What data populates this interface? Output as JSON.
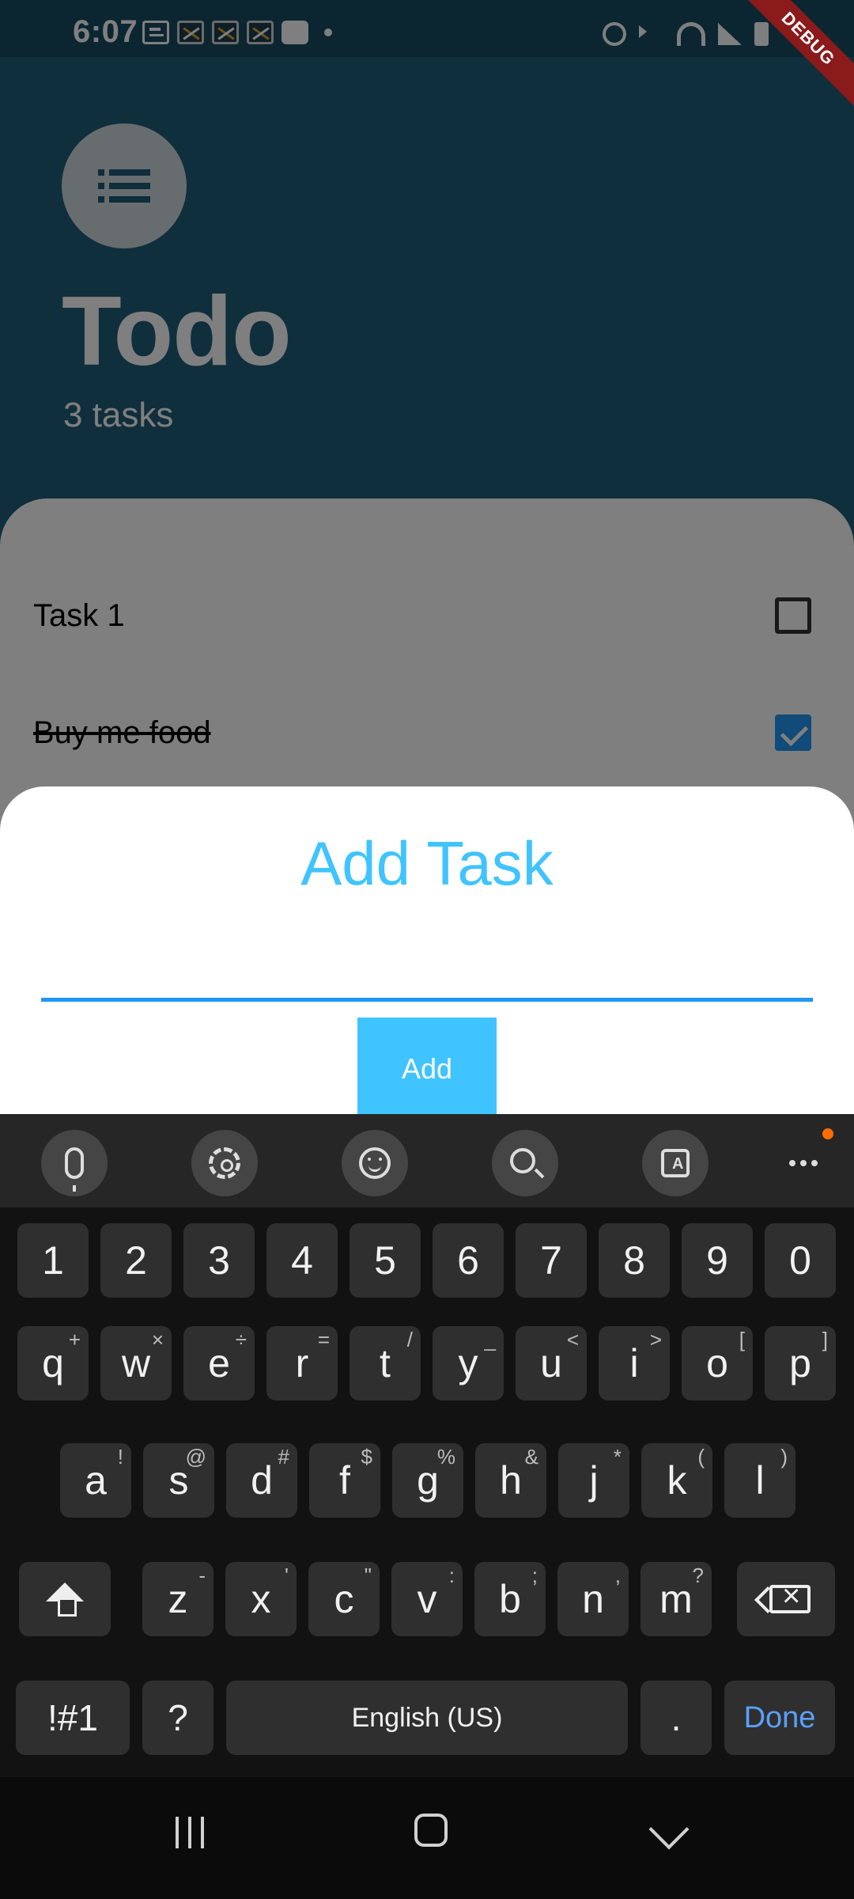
{
  "status_bar": {
    "time": "6:07",
    "debug_banner": "DEBUG"
  },
  "app": {
    "title": "Todo",
    "subtitle": "3 tasks"
  },
  "tasks": [
    {
      "label": "Task 1",
      "done": false
    },
    {
      "label": "Buy me food",
      "done": true
    }
  ],
  "dialog": {
    "title": "Add Task",
    "input_value": "",
    "add_label": "Add"
  },
  "keyboard": {
    "toolbar": [
      "mic-icon",
      "gear-icon",
      "emoji-icon",
      "search-icon",
      "translate-icon",
      "more-icon"
    ],
    "numbers": [
      "1",
      "2",
      "3",
      "4",
      "5",
      "6",
      "7",
      "8",
      "9",
      "0"
    ],
    "row1": [
      {
        "key": "q",
        "sup": "+"
      },
      {
        "key": "w",
        "sup": "×"
      },
      {
        "key": "e",
        "sup": "÷"
      },
      {
        "key": "r",
        "sup": "="
      },
      {
        "key": "t",
        "sup": "/"
      },
      {
        "key": "y",
        "sup": "_"
      },
      {
        "key": "u",
        "sup": "<"
      },
      {
        "key": "i",
        "sup": ">"
      },
      {
        "key": "o",
        "sup": "["
      },
      {
        "key": "p",
        "sup": "]"
      }
    ],
    "row2": [
      {
        "key": "a",
        "sup": "!"
      },
      {
        "key": "s",
        "sup": "@"
      },
      {
        "key": "d",
        "sup": "#"
      },
      {
        "key": "f",
        "sup": "$"
      },
      {
        "key": "g",
        "sup": "%"
      },
      {
        "key": "h",
        "sup": "&"
      },
      {
        "key": "j",
        "sup": "*"
      },
      {
        "key": "k",
        "sup": "("
      },
      {
        "key": "l",
        "sup": ")"
      }
    ],
    "row3": [
      {
        "key": "z",
        "sup": "-"
      },
      {
        "key": "x",
        "sup": "'"
      },
      {
        "key": "c",
        "sup": "\""
      },
      {
        "key": "v",
        "sup": ":"
      },
      {
        "key": "b",
        "sup": ";"
      },
      {
        "key": "n",
        "sup": ","
      },
      {
        "key": "m",
        "sup": "?"
      }
    ],
    "symbols_label": "!#1",
    "question_label": "?",
    "space_label": "English (US)",
    "period_label": ".",
    "done_label": "Done"
  },
  "colors": {
    "app_header": "#205e79",
    "accent": "#40c4ff",
    "input_underline": "#2196f3",
    "keyboard_bg": "#121212"
  }
}
